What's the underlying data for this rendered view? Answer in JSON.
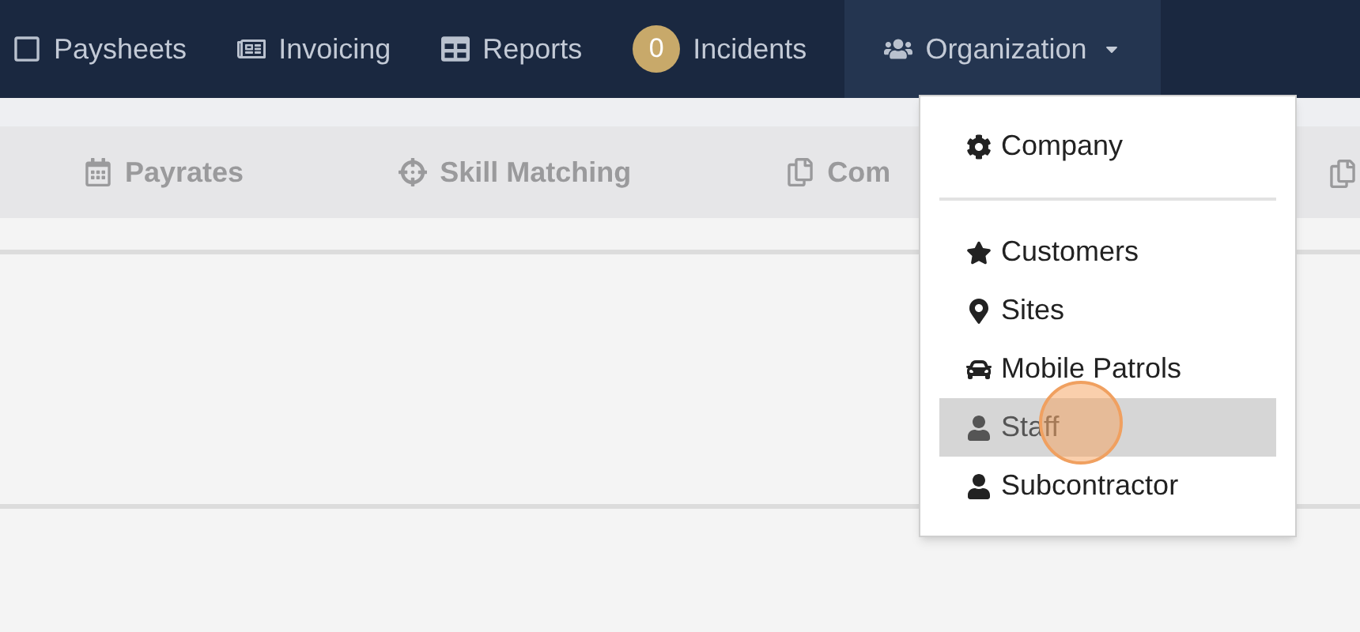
{
  "nav": [
    {
      "label": "Paysheets"
    },
    {
      "label": "Invoicing"
    },
    {
      "label": "Reports"
    },
    {
      "label": "Incidents",
      "badge": "0"
    },
    {
      "label": "Organization",
      "expanded": true
    }
  ],
  "subnav": [
    {
      "label": "Payrates"
    },
    {
      "label": "Skill Matching"
    },
    {
      "label": "Com"
    }
  ],
  "menu": [
    {
      "kind": "item",
      "label": "Company",
      "selected": false
    },
    {
      "kind": "divider"
    },
    {
      "kind": "item",
      "label": "Customers",
      "selected": false
    },
    {
      "kind": "item",
      "label": "Sites",
      "selected": false
    },
    {
      "kind": "item",
      "label": "Mobile Patrols",
      "selected": false
    },
    {
      "kind": "item",
      "label": "Staff",
      "selected": true
    },
    {
      "kind": "item",
      "label": "Subcontractor",
      "selected": false
    }
  ]
}
